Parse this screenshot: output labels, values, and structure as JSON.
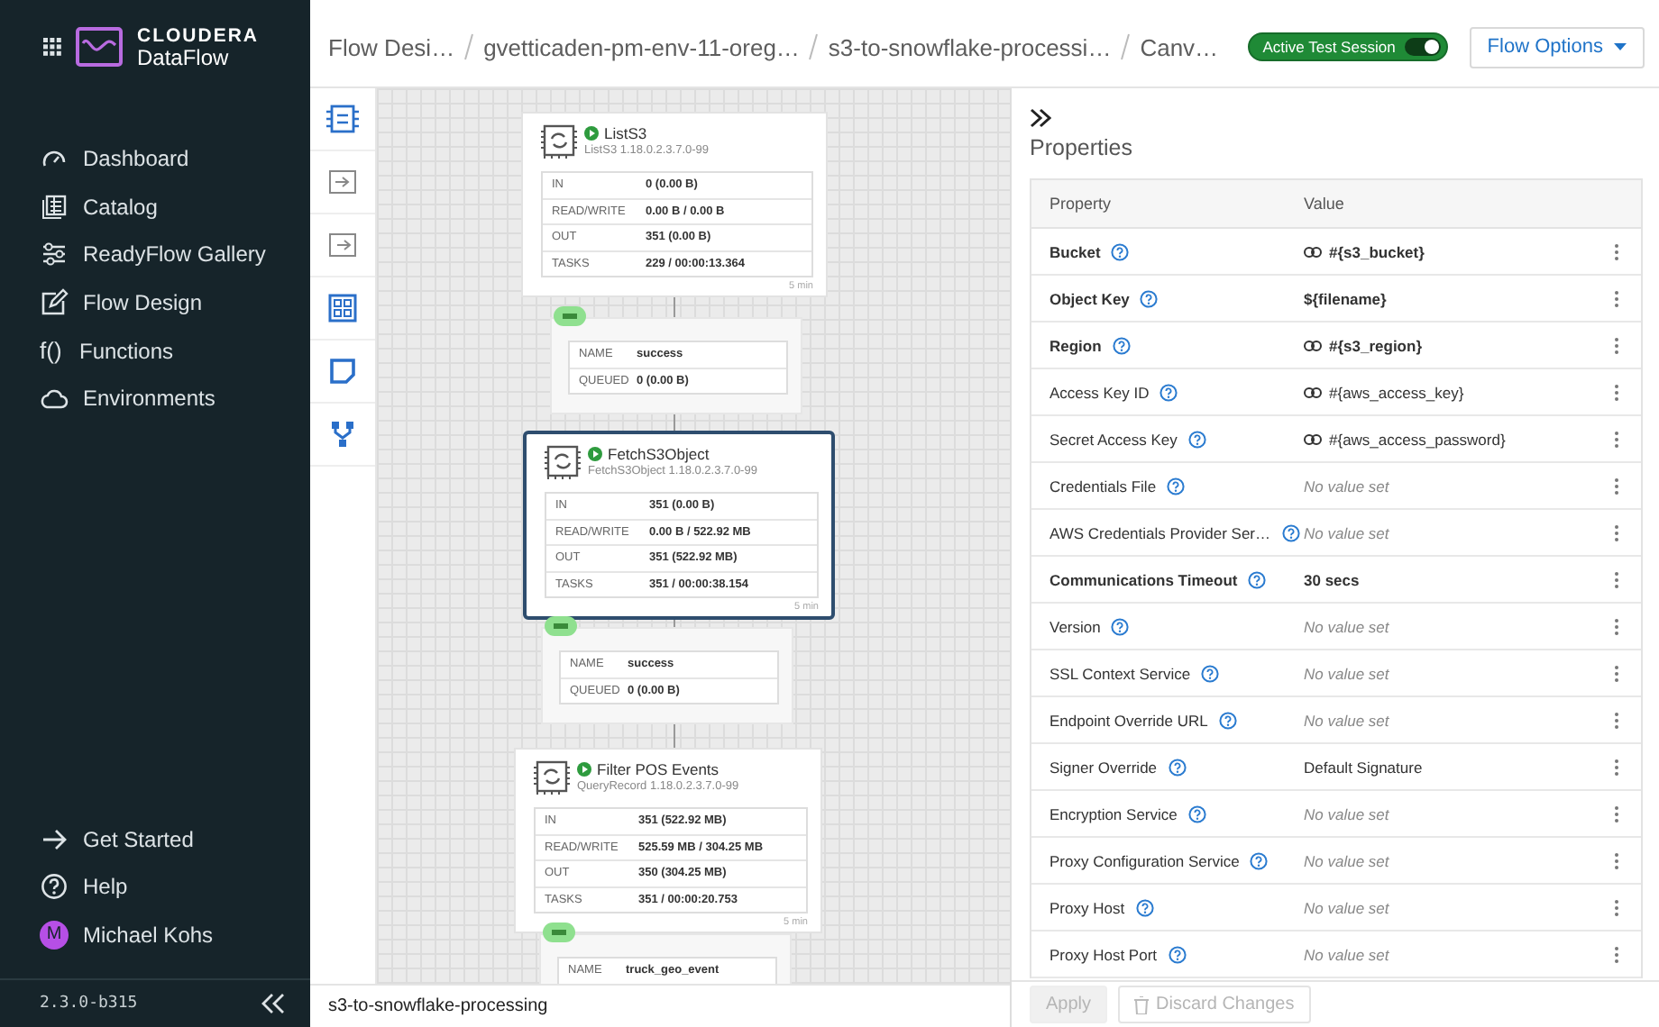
{
  "sidebar": {
    "brand": {
      "company": "CLOUDERA",
      "product": "DataFlow"
    },
    "nav": [
      {
        "kind": "dashboard",
        "label": "Dashboard",
        "selected": false
      },
      {
        "kind": "catalog",
        "label": "Catalog",
        "selected": false
      },
      {
        "kind": "readyflow",
        "label": "ReadyFlow Gallery",
        "selected": false
      },
      {
        "kind": "design",
        "label": "Flow Design",
        "selected": false
      },
      {
        "kind": "glyph",
        "glyph": "f()",
        "label": "Functions",
        "selected": false
      },
      {
        "kind": "environments",
        "label": "Environments",
        "selected": false
      }
    ],
    "bottom": [
      {
        "kind": "start",
        "label": "Get Started"
      },
      {
        "kind": "help",
        "label": "Help"
      }
    ],
    "user": {
      "initial": "M",
      "name": "Michael Kohs"
    },
    "version": "2.3.0-b315"
  },
  "header": {
    "breadcrumbs": [
      "Flow Desi…",
      "gvetticaden-pm-env-11-oreg…",
      "s3-to-snowflake-processi…",
      "Canv…"
    ],
    "test_session": {
      "label": "Active Test Session",
      "on": true
    },
    "flow_options": "Flow Options"
  },
  "canvas": {
    "items": [
      {
        "kind": "processor",
        "name": "ListS3",
        "type": "ListS3 1.18.0.2.3.7.0-99",
        "running": true,
        "selected": false,
        "stats": [
          {
            "label": "IN",
            "value": "0 (0.00 B)"
          },
          {
            "label": "READ/WRITE",
            "value": "0.00 B / 0.00 B"
          },
          {
            "label": "OUT",
            "value": "351 (0.00 B)"
          },
          {
            "label": "TASKS",
            "value": "229 / 00:00:13.364"
          }
        ],
        "period": "5 min"
      },
      {
        "kind": "connection",
        "rows": [
          {
            "label": "NAME",
            "value": "success"
          },
          {
            "label": "QUEUED",
            "value": "0 (0.00 B)"
          }
        ]
      },
      {
        "kind": "processor",
        "name": "FetchS3Object",
        "type": "FetchS3Object 1.18.0.2.3.7.0-99",
        "running": true,
        "selected": true,
        "stats": [
          {
            "label": "IN",
            "value": "351 (0.00 B)"
          },
          {
            "label": "READ/WRITE",
            "value": "0.00 B / 522.92 MB"
          },
          {
            "label": "OUT",
            "value": "351 (522.92 MB)"
          },
          {
            "label": "TASKS",
            "value": "351 / 00:00:38.154"
          }
        ],
        "period": "5 min"
      },
      {
        "kind": "connection",
        "rows": [
          {
            "label": "NAME",
            "value": "success"
          },
          {
            "label": "QUEUED",
            "value": "0 (0.00 B)"
          }
        ]
      },
      {
        "kind": "processor",
        "name": "Filter POS Events",
        "type": "QueryRecord 1.18.0.2.3.7.0-99",
        "running": true,
        "selected": false,
        "stats": [
          {
            "label": "IN",
            "value": "351 (522.92 MB)"
          },
          {
            "label": "READ/WRITE",
            "value": "525.59 MB / 304.25 MB"
          },
          {
            "label": "OUT",
            "value": "350 (304.25 MB)"
          },
          {
            "label": "TASKS",
            "value": "351 / 00:00:20.753"
          }
        ],
        "period": "5 min"
      },
      {
        "kind": "connection",
        "rows": [
          {
            "label": "NAME",
            "value": "truck_geo_event"
          }
        ]
      }
    ],
    "flow_name": "s3-to-snowflake-processing"
  },
  "properties": {
    "title": "Properties",
    "columns": [
      "Property",
      "Value"
    ],
    "rows": [
      {
        "name": "Bucket",
        "required": true,
        "kind": "parameter",
        "value": "#{s3_bucket}"
      },
      {
        "name": "Object Key",
        "required": true,
        "kind": "plain",
        "value": "${filename}"
      },
      {
        "name": "Region",
        "required": true,
        "kind": "parameter",
        "value": "#{s3_region}"
      },
      {
        "name": "Access Key ID",
        "required": false,
        "kind": "parameter",
        "value": "#{aws_access_key}"
      },
      {
        "name": "Secret Access Key",
        "required": false,
        "kind": "parameter",
        "value": "#{aws_access_password}"
      },
      {
        "name": "Credentials File",
        "required": false,
        "kind": "unset",
        "value": "No value set"
      },
      {
        "name": "AWS Credentials Provider Ser…",
        "required": false,
        "kind": "unset",
        "value": "No value set"
      },
      {
        "name": "Communications Timeout",
        "required": true,
        "kind": "plain",
        "value": "30 secs"
      },
      {
        "name": "Version",
        "required": false,
        "kind": "unset",
        "value": "No value set"
      },
      {
        "name": "SSL Context Service",
        "required": false,
        "kind": "unset",
        "value": "No value set"
      },
      {
        "name": "Endpoint Override URL",
        "required": false,
        "kind": "unset",
        "value": "No value set"
      },
      {
        "name": "Signer Override",
        "required": false,
        "kind": "plain",
        "value": "Default Signature"
      },
      {
        "name": "Encryption Service",
        "required": false,
        "kind": "unset",
        "value": "No value set"
      },
      {
        "name": "Proxy Configuration Service",
        "required": false,
        "kind": "unset",
        "value": "No value set"
      },
      {
        "name": "Proxy Host",
        "required": false,
        "kind": "unset",
        "value": "No value set"
      },
      {
        "name": "Proxy Host Port",
        "required": false,
        "kind": "unset",
        "value": "No value set"
      }
    ],
    "buttons": [
      {
        "kind": "apply",
        "label": "Apply",
        "disabled": true
      },
      {
        "kind": "discard",
        "label": "Discard Changes",
        "disabled": true
      }
    ]
  }
}
